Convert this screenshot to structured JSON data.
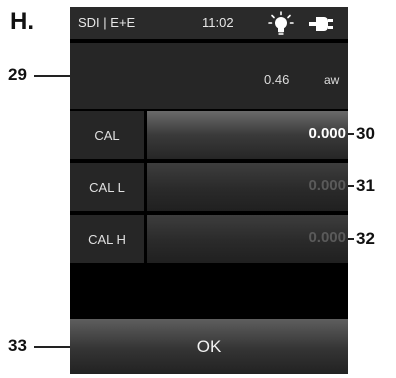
{
  "figure": {
    "letter": "H.",
    "callouts": [
      "29",
      "30",
      "31",
      "32",
      "33"
    ]
  },
  "status_bar": {
    "title": "SDI | E+E",
    "time": "11:02",
    "icons": [
      "light-bulb-icon",
      "power-plug-icon"
    ]
  },
  "reading": {
    "value": "0.46",
    "unit": "aw"
  },
  "rows": [
    {
      "label": "CAL",
      "value": "0.000",
      "active": true
    },
    {
      "label": "CAL L",
      "value": "0.000",
      "active": false
    },
    {
      "label": "CAL H",
      "value": "0.000",
      "active": false
    }
  ],
  "ok_button": {
    "label": "OK"
  },
  "colors": {
    "screen_background": "#000000",
    "panel": "#262626",
    "active_value": "#ffffff",
    "inactive_value": "#5a5a5a"
  }
}
